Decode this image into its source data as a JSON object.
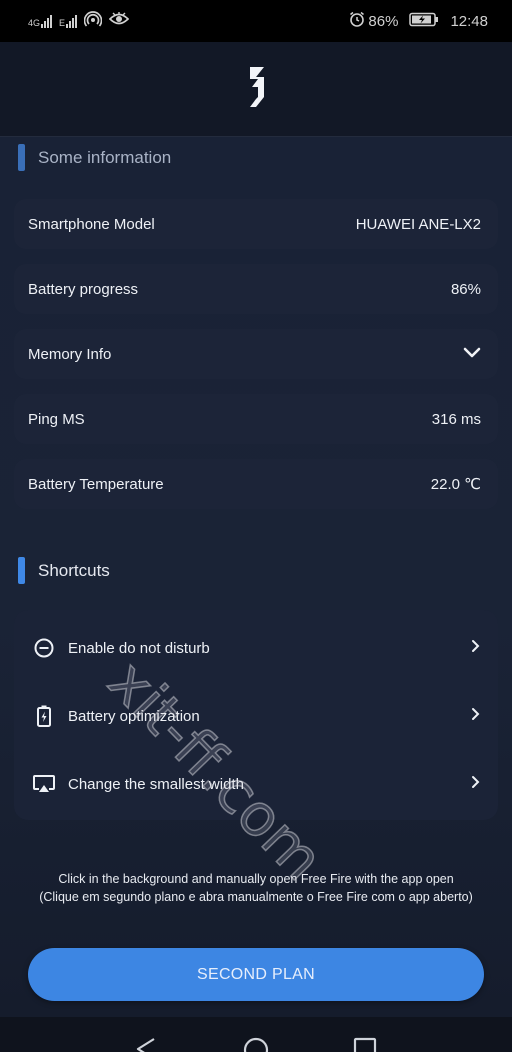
{
  "status_bar": {
    "net1": "4G",
    "net2": "E",
    "battery_percent": "86%",
    "time": "12:48",
    "icons": [
      "signal-4g-icon",
      "signal-e-icon",
      "hotspot-icon",
      "eye-icon",
      "alarm-icon",
      "battery-icon"
    ]
  },
  "header": {
    "logo_icon": "app-logo-icon"
  },
  "info_section": {
    "title": "Some information",
    "rows": [
      {
        "label": "Smartphone Model",
        "value": "HUAWEI ANE-LX2"
      },
      {
        "label": "Battery progress",
        "value": "86%"
      },
      {
        "label": "Memory Info",
        "icon": "chevron-down-icon"
      },
      {
        "label": "Ping MS",
        "value": "316 ms"
      },
      {
        "label": "Battery Temperature",
        "value": "22.0 ℃"
      }
    ]
  },
  "shortcuts": {
    "title": "Shortcuts",
    "items": [
      {
        "label": "Enable do not disturb",
        "icon": "do-not-disturb-icon"
      },
      {
        "label": "Battery optimization",
        "icon": "battery-charging-icon"
      },
      {
        "label": "Change the smallest width",
        "icon": "cast-screen-icon"
      }
    ]
  },
  "note": {
    "line1": "Click in the background and manually open Free Fire with the app open",
    "line2": "(Clique em segundo plano e abra manualmente o Free Fire com o app aberto)"
  },
  "button": {
    "label": "SECOND PLAN"
  },
  "watermark": "xit-ff.com",
  "colors": {
    "accent": "#3d86e3",
    "background": "#192236",
    "row": "#1c2438"
  }
}
